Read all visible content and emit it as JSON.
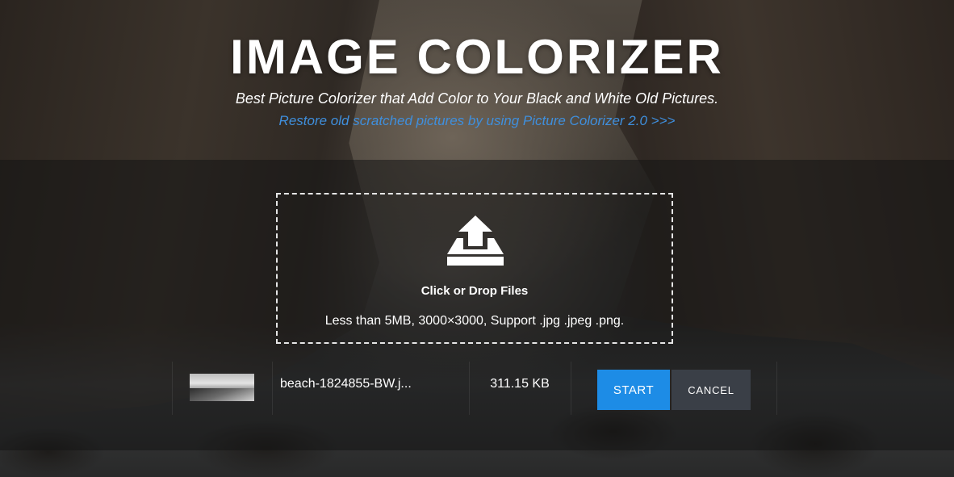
{
  "header": {
    "title": "IMAGE COLORIZER",
    "subtitle": "Best Picture Colorizer that Add Color to Your Black and White Old Pictures.",
    "restore_link": "Restore old scratched pictures by using Picture Colorizer 2.0 >>>"
  },
  "dropzone": {
    "icon": "upload-tray-icon",
    "title": "Click or Drop Files",
    "hint": "Less than 5MB, 3000×3000, Support .jpg .jpeg .png."
  },
  "file": {
    "thumbnail": "beach-thumbnail-image",
    "name": "beach-1824855-BW.j...",
    "size": "311.15 KB",
    "start_label": "START",
    "cancel_label": "CANCEL"
  },
  "colors": {
    "link": "#3f8fdd",
    "start_button": "#1d8ce6",
    "cancel_button": "#3a3f47"
  }
}
